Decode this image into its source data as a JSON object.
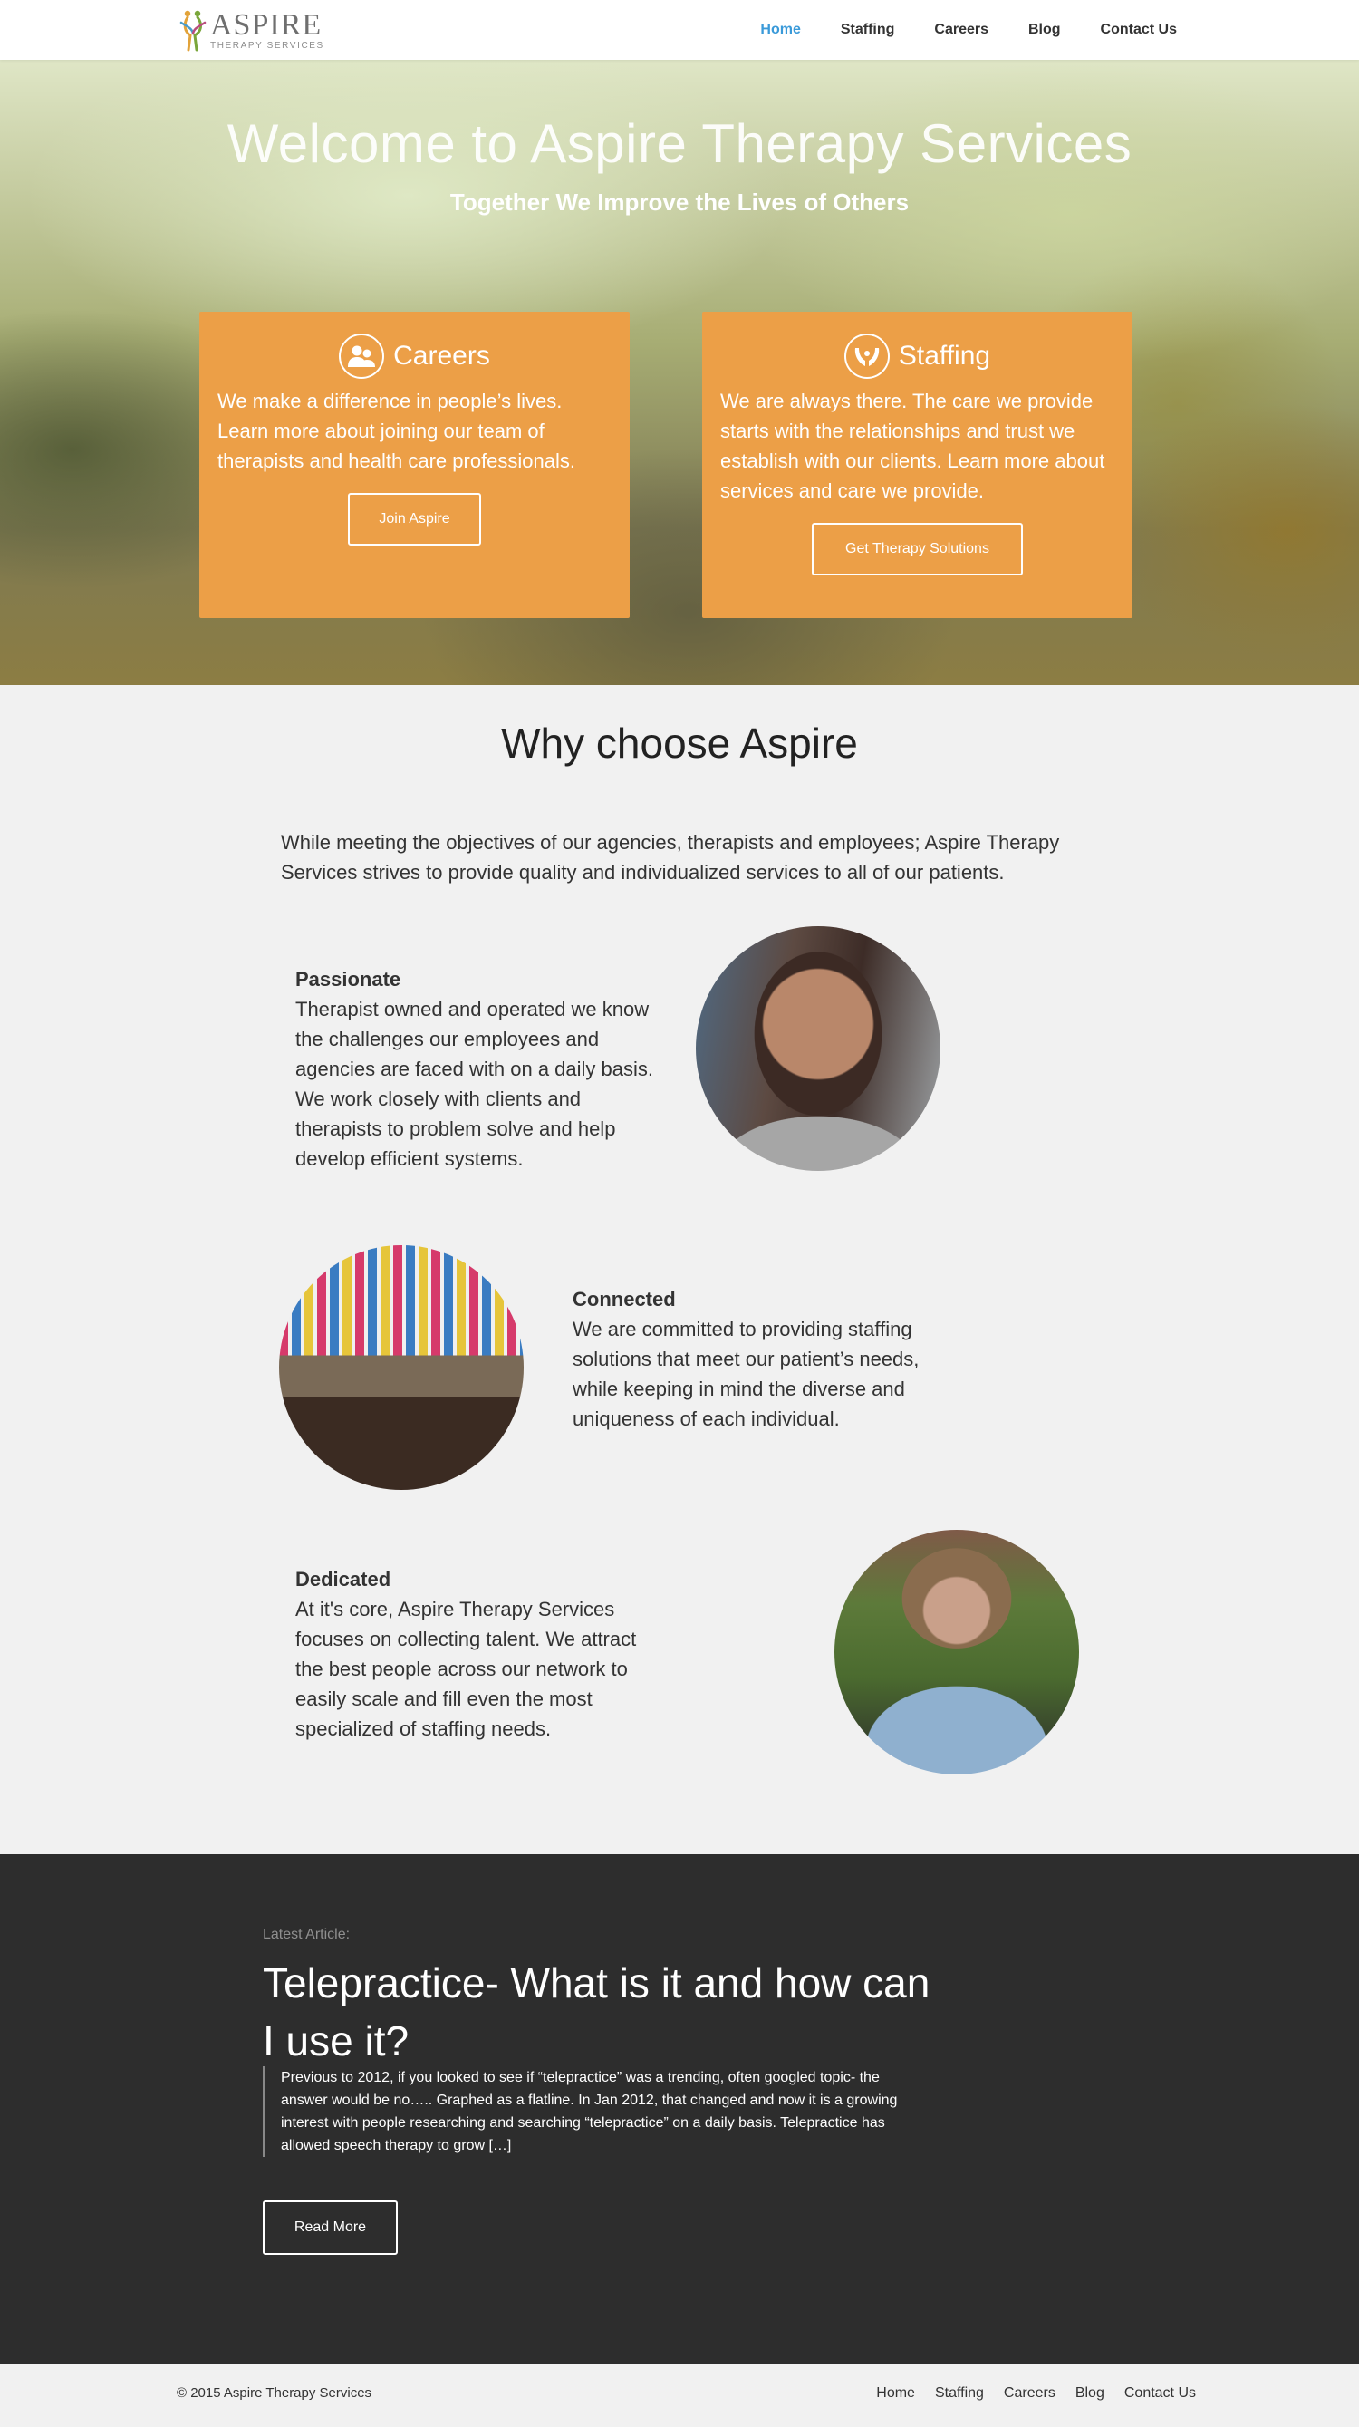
{
  "brand": {
    "name": "ASPIRE",
    "tagline": "THERAPY SERVICES"
  },
  "nav": {
    "items": [
      {
        "label": "Home",
        "active": true
      },
      {
        "label": "Staffing",
        "active": false
      },
      {
        "label": "Careers",
        "active": false
      },
      {
        "label": "Blog",
        "active": false
      },
      {
        "label": "Contact Us",
        "active": false
      }
    ]
  },
  "hero": {
    "title": "Welcome to Aspire Therapy Services",
    "subtitle": "Together We Improve the Lives of Others",
    "cards": [
      {
        "title": "Careers",
        "icon": "people-icon",
        "text": "We make a difference in people’s lives. Learn more about joining our team of therapists and health care professionals.",
        "button": "Join Aspire"
      },
      {
        "title": "Staffing",
        "icon": "caring-hands-icon",
        "text": "We are always there. The care we provide starts with the relationships and trust we establish with our clients. Learn more about services and care we provide.",
        "button": "Get Therapy Solutions"
      }
    ]
  },
  "why": {
    "title": "Why choose Aspire",
    "intro": "While meeting the objectives of our agencies, therapists and employees; Aspire Therapy Services strives to provide quality and individualized services to all of our patients.",
    "features": [
      {
        "title": "Passionate",
        "text": "Therapist owned and operated we know the challenges our employees and agencies are faced with on a daily basis. We work closely with clients and therapists to problem solve and help develop efficient systems."
      },
      {
        "title": "Connected",
        "text": "We are committed to providing staffing solutions that meet our patient’s needs, while keeping in mind the diverse and uniqueness of each individual."
      },
      {
        "title": "Dedicated",
        "text": "At it's core, Aspire Therapy Services focuses on collecting talent. We attract the best people across our network to easily scale and fill even the most specialized of staffing needs."
      }
    ]
  },
  "article": {
    "label": "Latest Article:",
    "title": "Telepractice- What is it and how can I use it?",
    "excerpt": "Previous to 2012, if you looked to see if “telepractice” was a trending, often googled topic- the answer would be no….. Graphed as a flatline.  In Jan 2012, that changed and now it is a growing interest with people researching and searching “telepractice” on a daily basis.  Telepractice has allowed speech therapy to grow […]",
    "button": "Read More"
  },
  "footer": {
    "copyright": "© 2015 Aspire Therapy Services",
    "links": [
      "Home",
      "Staffing",
      "Careers",
      "Blog",
      "Contact Us"
    ]
  },
  "colors": {
    "accent_orange": "#ec9f47",
    "nav_active": "#3a9ad9",
    "dark_band": "#2d2d2d",
    "page_bg": "#f1f1f1"
  }
}
